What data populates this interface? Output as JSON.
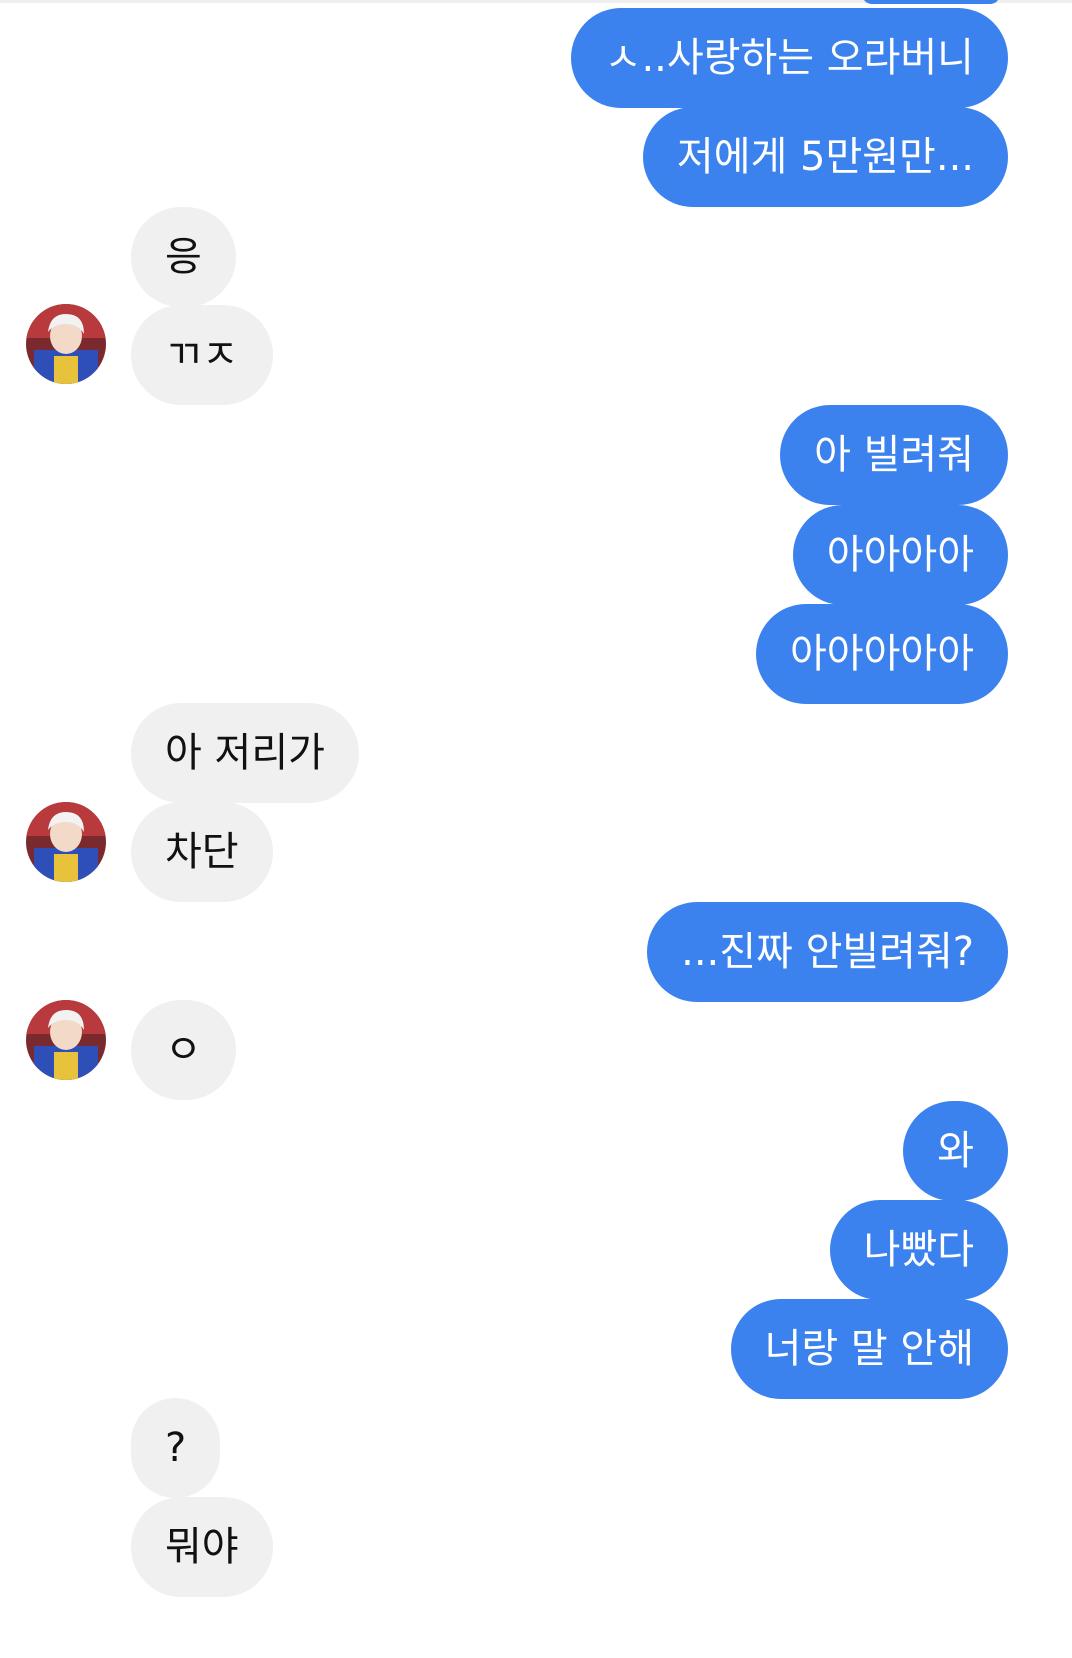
{
  "chat": {
    "colors": {
      "outgoing_bubble": "#3b82ee",
      "incoming_bubble": "#f0f0f0",
      "outgoing_text": "#ffffff",
      "incoming_text": "#111111"
    },
    "avatar_icon": "profile-avatar-icon",
    "messages": [
      {
        "side": "out",
        "text": "ㅅ..사랑하는 오라버니"
      },
      {
        "side": "out",
        "text": "저에게 5만원만..."
      },
      {
        "side": "in",
        "text": "응"
      },
      {
        "side": "in",
        "text": "ㄲㅈ"
      },
      {
        "side": "out",
        "text": "아 빌려줘"
      },
      {
        "side": "out",
        "text": "아아아아"
      },
      {
        "side": "out",
        "text": "아아아아아"
      },
      {
        "side": "in",
        "text": "아 저리가"
      },
      {
        "side": "in",
        "text": "차단"
      },
      {
        "side": "out",
        "text": "...진짜 안빌려줘?"
      },
      {
        "side": "in",
        "text": "ㅇ"
      },
      {
        "side": "out",
        "text": "와"
      },
      {
        "side": "out",
        "text": "나빴다"
      },
      {
        "side": "out",
        "text": "너랑 말 안해"
      },
      {
        "side": "in",
        "text": "?"
      },
      {
        "side": "in",
        "text": "뭐야"
      }
    ]
  }
}
